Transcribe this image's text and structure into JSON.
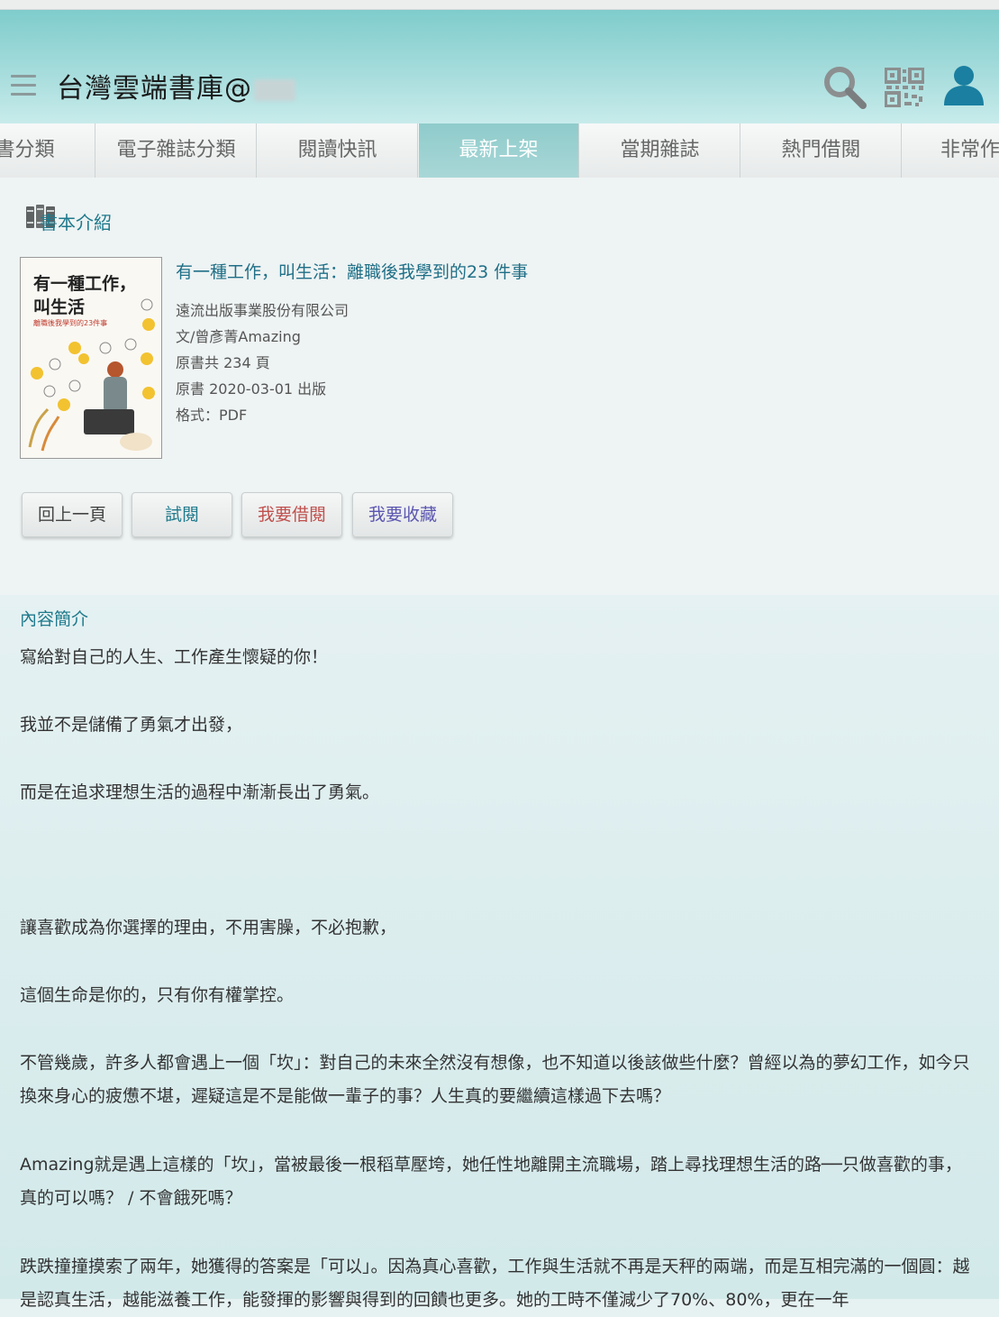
{
  "header": {
    "title": "台灣雲端書庫@"
  },
  "tabs": [
    "子書分類",
    "電子雜誌分類",
    "閱讀快訊",
    "最新上架",
    "當期雜誌",
    "熱門借閱",
    "非常作"
  ],
  "active_tab": "最新上架",
  "section": {
    "title": "書本介紹"
  },
  "book": {
    "cover_title_line1": "有一種工作，",
    "cover_title_line2": "叫生活",
    "cover_subtitle": "離職後我學到的23件事",
    "title": "有一種工作，叫生活：離職後我學到的23 件事",
    "publisher": "遠流出版事業股份有限公司",
    "author": "文/曾彥菁Amazing",
    "pages": "原書共 234 頁",
    "published": "原書 2020-03-01 出版",
    "format": "格式：PDF"
  },
  "buttons": {
    "back": "回上一頁",
    "trial": "試閱",
    "borrow": "我要借閱",
    "favorite": "我要收藏"
  },
  "content": {
    "heading": "內容簡介",
    "paragraphs": [
      "寫給對自己的人生、工作產生懷疑的你！",
      "我並不是儲備了勇氣才出發，",
      "而是在追求理想生活的過程中漸漸長出了勇氣。",
      "讓喜歡成為你選擇的理由，不用害臊，不必抱歉，",
      "這個生命是你的，只有你有權掌控。",
      "不管幾歲，許多人都會遇上一個「坎」：對自己的未來全然沒有想像，也不知道以後該做些什麼？曾經以為的夢幻工作，如今只換來身心的疲憊不堪，遲疑這是不是能做一輩子的事？人生真的要繼續這樣過下去嗎？",
      "Amazing就是遇上這樣的「坎」，當被最後一根稻草壓垮，她任性地離開主流職場，踏上尋找理想生活的路──只做喜歡的事，真的可以嗎？ / 不會餓死嗎？",
      "跌跌撞撞摸索了兩年，她獲得的答案是「可以」。因為真心喜歡，工作與生活就不再是天秤的兩端，而是互相完滿的一個圓：越是認真生活，越能滋養工作，能發揮的影響與得到的回饋也更多。她的工時不僅減少了70%、80%，更在一年"
    ]
  }
}
